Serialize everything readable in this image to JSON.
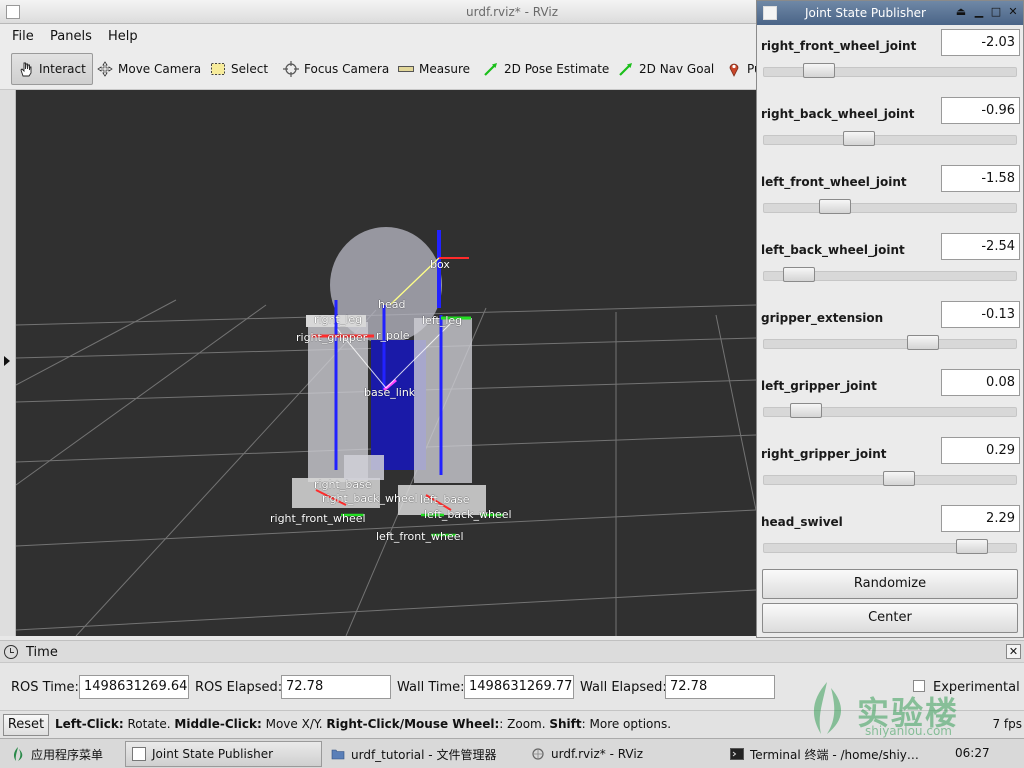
{
  "window": {
    "title": "urdf.rviz* - RViz"
  },
  "menu": [
    "File",
    "Panels",
    "Help"
  ],
  "toolbar": {
    "tools": [
      {
        "label": "Interact",
        "icon": "hand-icon",
        "active": true
      },
      {
        "label": "Move Camera",
        "icon": "move-arrows-icon"
      },
      {
        "label": "Select",
        "icon": "select-rect-icon"
      },
      {
        "label": "Focus Camera",
        "icon": "crosshair-icon"
      },
      {
        "label": "Measure",
        "icon": "ruler-icon"
      },
      {
        "label": "2D Pose Estimate",
        "icon": "green-arrow-icon"
      },
      {
        "label": "2D Nav Goal",
        "icon": "green-arrow-icon"
      },
      {
        "label": "Pu",
        "icon": "map-pin-icon"
      }
    ]
  },
  "viewport": {
    "background": "#303030",
    "tf_labels": {
      "box": "box",
      "head": "head",
      "right_leg": "right_leg",
      "left_leg": "left_leg",
      "right_gripper": "right_gripper",
      "gripper_pole": "r_pole",
      "base_link": "base_link",
      "right_base": "right_base",
      "right_back_wheel": "right_back_wheel",
      "right_front_wheel": "right_front_wheel",
      "left_base": "left_base",
      "left_back_wheel": "left_back_wheel",
      "left_front_wheel": "left_front_wheel"
    }
  },
  "time_panel": {
    "title": "Time",
    "ros_time_label": "ROS Time:",
    "ros_time": "1498631269.64",
    "ros_elapsed_label": "ROS Elapsed:",
    "ros_elapsed": "72.78",
    "wall_time_label": "Wall Time:",
    "wall_time": "1498631269.77",
    "wall_elapsed_label": "Wall Elapsed:",
    "wall_elapsed": "72.78",
    "experimental_label": "Experimental"
  },
  "status_bar": {
    "reset_label": "Reset",
    "help": {
      "k1": "Left-Click:",
      "v1": " Rotate. ",
      "k2": "Middle-Click:",
      "v2": " Move X/Y. ",
      "k3": "Right-Click/Mouse Wheel:",
      "v3": ": Zoom. ",
      "k4": "Shift",
      "v4": ": More options."
    },
    "fps": "7 fps"
  },
  "joint_state_publisher": {
    "title": "Joint State Publisher",
    "joints": [
      {
        "name": "right_front_wheel_joint",
        "value": "-2.03",
        "slider": 0.18
      },
      {
        "name": "right_back_wheel_joint",
        "value": "-0.96",
        "slider": 0.36
      },
      {
        "name": "left_front_wheel_joint",
        "value": "-1.58",
        "slider": 0.25
      },
      {
        "name": "left_back_wheel_joint",
        "value": "-2.54",
        "slider": 0.09
      },
      {
        "name": "gripper_extension",
        "value": "-0.13",
        "slider": 0.65
      },
      {
        "name": "left_gripper_joint",
        "value": "0.08",
        "slider": 0.12
      },
      {
        "name": "right_gripper_joint",
        "value": "0.29",
        "slider": 0.54
      },
      {
        "name": "head_swivel",
        "value": "2.29",
        "slider": 0.87
      }
    ],
    "randomize_label": "Randomize",
    "center_label": "Center"
  },
  "taskbar": {
    "start_label": "应用程序菜单",
    "items": [
      {
        "label": "Joint State Publisher",
        "active": true
      },
      {
        "label": "urdf_tutorial - 文件管理器"
      },
      {
        "label": "urdf.rviz* - RViz"
      },
      {
        "label": "Terminal 终端 - /home/shiy…"
      }
    ],
    "clock": "06:27"
  },
  "watermark": {
    "cn": "实验楼",
    "en": "shiyanlou.com"
  }
}
